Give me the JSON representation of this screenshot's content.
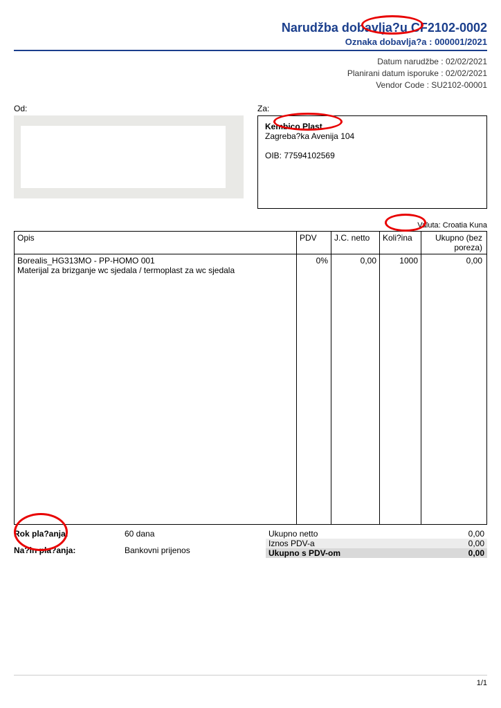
{
  "header": {
    "title": "Narudžba dobavlja?u CF2102-0002",
    "sub": "Oznaka dobavlja?a : 000001/2021",
    "date_label": "Datum narudžbe : 02/02/2021",
    "planned_label": "Planirani datum isporuke : 02/02/2021",
    "vendor_label": "Vendor Code : SU2102-00001"
  },
  "from_label": "Od:",
  "to_label": "Za:",
  "to": {
    "name": "Kembico Plast",
    "addr": "Zagreba?ka Avenija 104",
    "oib": "OIB: 77594102569"
  },
  "currency": "Valuta: Croatia Kuna",
  "th": {
    "opis": "Opis",
    "pdv": "PDV",
    "jc": "J.C. netto",
    "kol": "Koli?ina",
    "uk": "Ukupno (bez poreza)"
  },
  "item": {
    "line1": "Borealis_HG313MO - PP-HOMO 001",
    "line2": "Materijal za brizganje wc sjedala / termoplast za wc sjedala",
    "pdv": "0%",
    "jc": "0,00",
    "kol": "1000",
    "uk": "0,00"
  },
  "pay": {
    "rok_lbl": "Rok pla?anja:",
    "rok_val": "60 dana",
    "nacin_lbl": "Na?in pla?anja:",
    "nacin_val": "Bankovni prijenos"
  },
  "totals": {
    "netto_lbl": "Ukupno netto",
    "netto_val": "0,00",
    "pdv_lbl": "Iznos PDV-a",
    "pdv_val": "0,00",
    "tot_lbl": "Ukupno s PDV-om",
    "tot_val": "0,00"
  },
  "page": "1/1"
}
